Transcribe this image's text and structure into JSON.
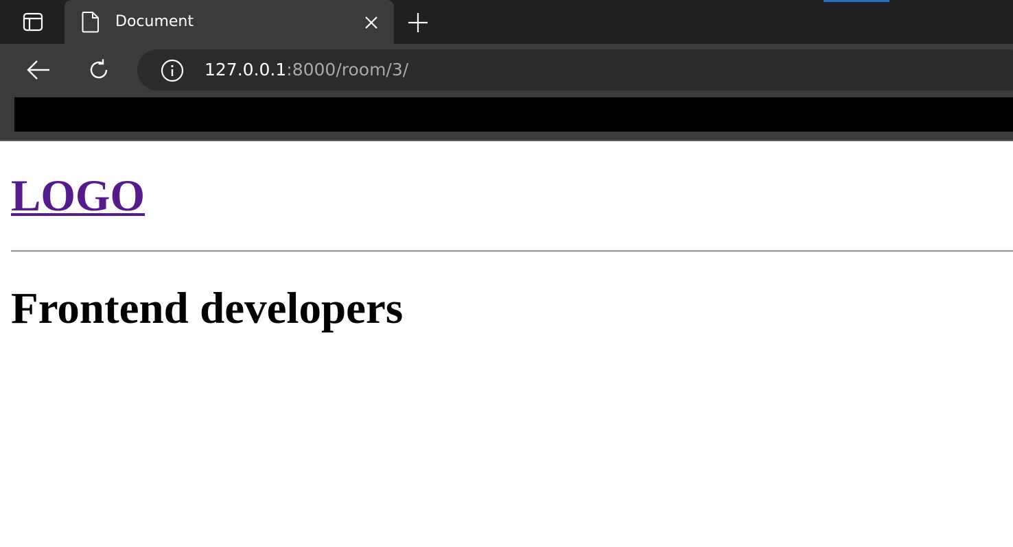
{
  "browser": {
    "tab": {
      "title": "Document"
    },
    "address_bar": {
      "url_host": "127.0.0.1",
      "url_rest": ":8000/room/3/"
    },
    "icons": {
      "tab_actions": "tab-actions-icon",
      "page": "page-icon",
      "close": "close-icon",
      "new_tab": "plus-icon",
      "back": "back-arrow-icon",
      "refresh": "refresh-icon",
      "site_info": "info-icon"
    },
    "colors": {
      "tab_strip": "#202020",
      "toolbar": "#3b3b3b",
      "address_bar": "#2b2b2b",
      "accent": "#1a73c7"
    }
  },
  "page": {
    "logo_label": "LOGO",
    "title": "Frontend developers",
    "colors": {
      "visited_link": "#551a8b",
      "text": "#000000"
    }
  }
}
